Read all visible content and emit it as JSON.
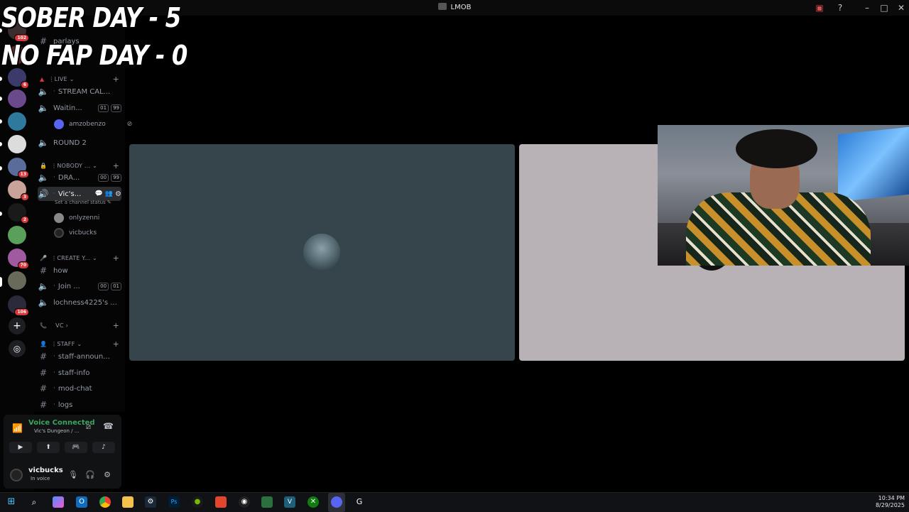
{
  "window": {
    "title": "LMOB"
  },
  "overlay": {
    "line1": "SOBER DAY - 5",
    "line2": "NO FAP DAY - 0"
  },
  "servers": [
    {
      "badge": "102",
      "color": "#3a2d2d"
    },
    {
      "badge": "",
      "color": "#5b2a2a"
    },
    {
      "badge": "6",
      "color": "#3b3b6b"
    },
    {
      "badge": "",
      "color": "#6b4a8c"
    },
    {
      "badge": "",
      "color": "#2d7a9c"
    },
    {
      "badge": "",
      "color": "#dcdcdc"
    },
    {
      "badge": "13",
      "color": "#5a6c9a"
    },
    {
      "badge": "3",
      "color": "#c9a29a"
    },
    {
      "badge": "2",
      "color": "#1a1a1a"
    },
    {
      "badge": "",
      "color": "#5aa05a"
    },
    {
      "badge": "70",
      "color": "#a05aa0"
    },
    {
      "badge": "",
      "color": "#6a6a5a"
    },
    {
      "badge": "106",
      "color": "#2a2a3a"
    }
  ],
  "sidebar": {
    "hidden_channel": "parlays",
    "categories": {
      "live": "LIVE",
      "nobody": "NOBODY ...",
      "create": "CREATE Y...",
      "vc": "VC",
      "staff": "STAFF"
    },
    "channels": {
      "stream_cal": "STREAM CAL...",
      "waitin": "Waitin...",
      "waitin_c1": "01",
      "waitin_c2": "99",
      "round2": "ROUND 2",
      "dra": "DRA...",
      "dra_c1": "00",
      "dra_c2": "99",
      "vics": "Vic's...",
      "how": "how",
      "join": "Join ...",
      "join_c1": "00",
      "join_c2": "01",
      "lochness": "lochness4225's ...",
      "staff_announ": "staff-announ...",
      "staff_info": "staff-info",
      "mod_chat": "mod-chat",
      "logs": "logs"
    },
    "members": {
      "amzobenzo": "amzobenzo",
      "onlyzenni": "onlyzenni",
      "vicbucks": "vicbucks"
    },
    "set_status": "Set a channel status"
  },
  "voice": {
    "title": "Voice Connected",
    "subtitle": "Vic's Dungeon / ..."
  },
  "user": {
    "name": "vicbucks",
    "status": "In voice"
  },
  "clock": {
    "time": "10:34 PM",
    "date": "8/29/2025"
  }
}
